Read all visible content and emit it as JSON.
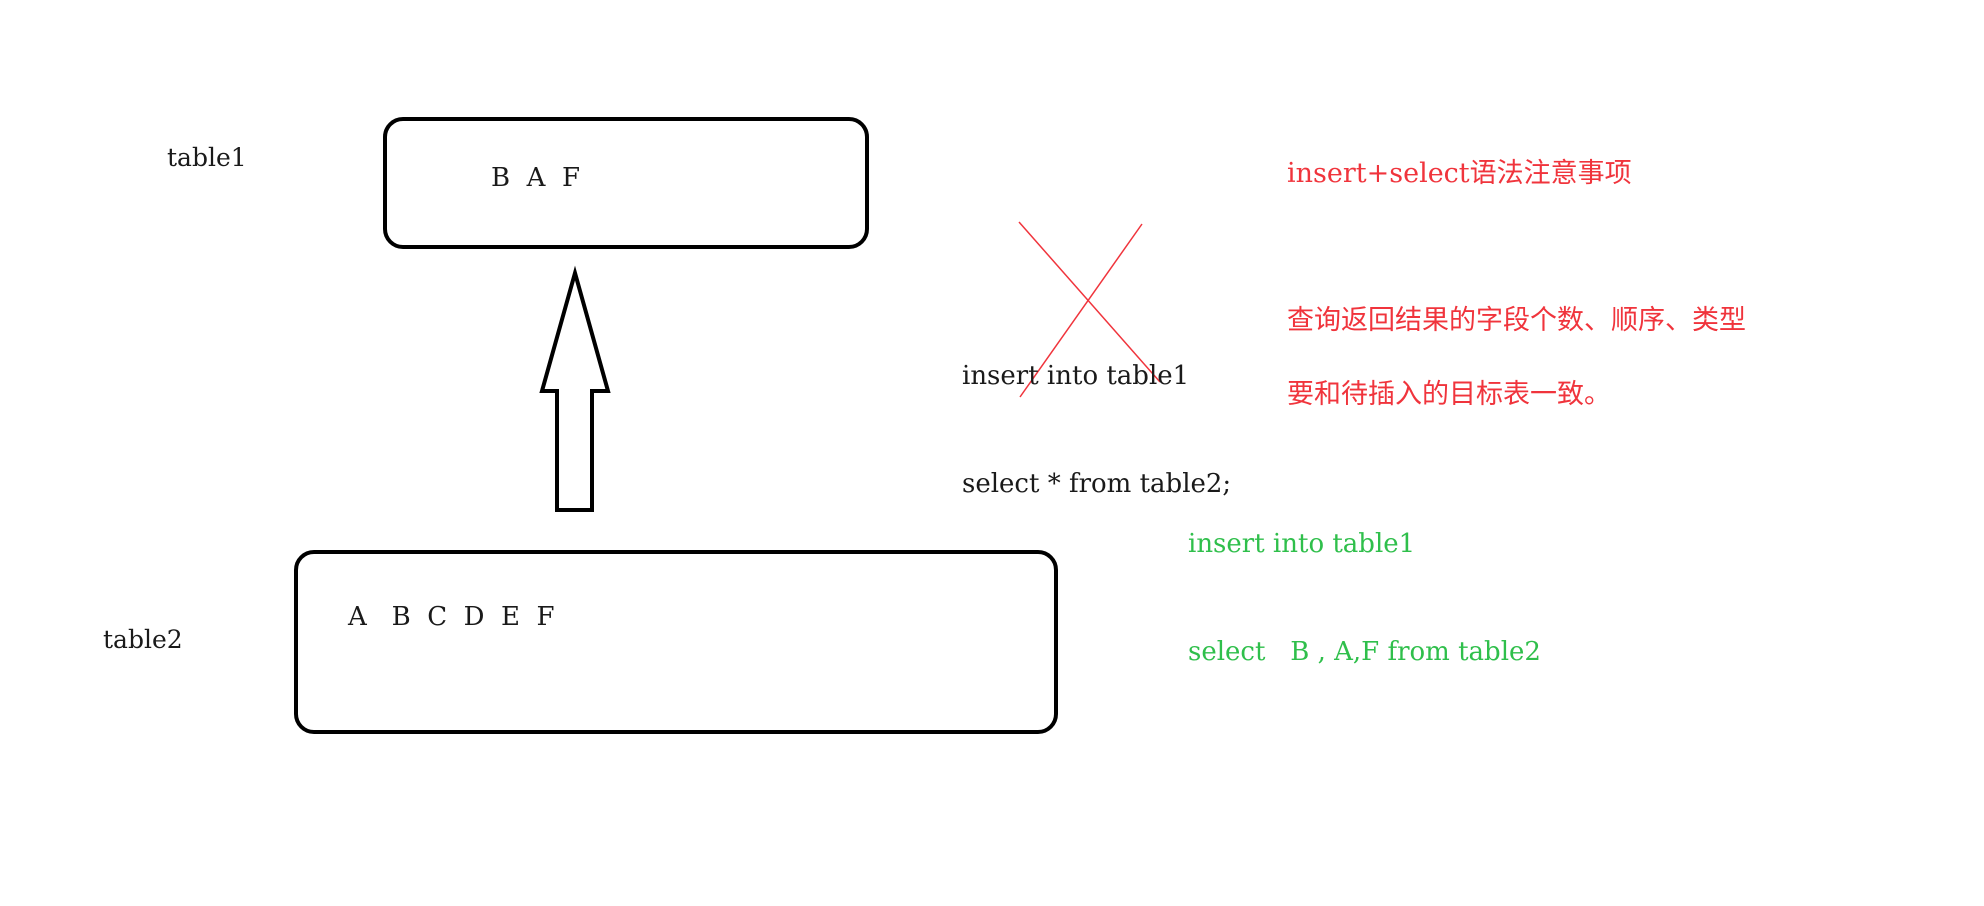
{
  "table1": {
    "label": "table1",
    "columns": "B  A  F"
  },
  "table2": {
    "label": "table2",
    "columns": "A   B  C  D  E  F"
  },
  "wrong_sql": {
    "line1": "insert into table1",
    "line2": "select * from table2;"
  },
  "correct_sql": {
    "line1": "insert into table1",
    "line2": "select   B , A,F from table2"
  },
  "note": {
    "title": "insert+select语法注意事项",
    "line1": "查询返回结果的字段个数、顺序、类型",
    "line2": "要和待插入的目标表一致。"
  },
  "colors": {
    "note": "#f0343c",
    "correct_sql": "#2fbf4b",
    "cross": "#f0343c",
    "outline": "#000000"
  },
  "icons": {
    "arrow": "up-arrow-icon",
    "cross": "cross-out-icon"
  }
}
